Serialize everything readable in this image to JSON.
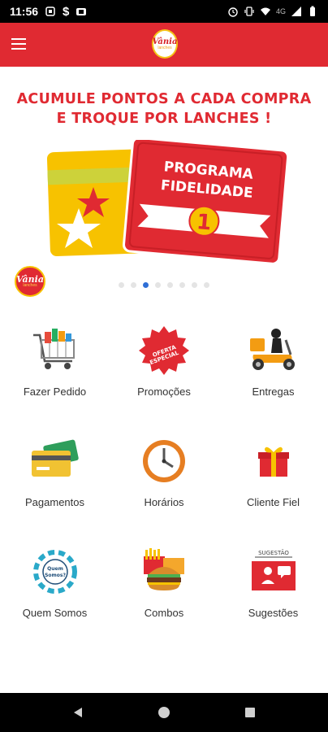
{
  "status_bar": {
    "time": "11:56",
    "network": "4G"
  },
  "app_bar": {
    "logo_script": "Vânia",
    "logo_tag": "lanches"
  },
  "banner": {
    "headline_line1": "ACUMULE PONTOS A CADA COMPRA",
    "headline_line2": "E TROQUE POR LANCHES !",
    "card_title_line1": "PROGRAMA",
    "card_title_line2": "FIDELIDADE",
    "card_number": "1",
    "logo_script": "Vânia",
    "logo_tag": "lanches",
    "dots_count": 8,
    "active_dot": 2
  },
  "menu": {
    "items": [
      {
        "label": "Fazer Pedido",
        "icon": "shopping-cart-icon"
      },
      {
        "label": "Promoções",
        "icon": "special-offer-badge-icon",
        "badge_text": "OFERTA ESPECIAL"
      },
      {
        "label": "Entregas",
        "icon": "delivery-scooter-icon"
      },
      {
        "label": "Pagamentos",
        "icon": "payment-cards-icon"
      },
      {
        "label": "Horários",
        "icon": "clock-icon"
      },
      {
        "label": "Cliente Fiel",
        "icon": "gift-box-icon"
      },
      {
        "label": "Quem Somos",
        "icon": "about-us-people-icon",
        "badge_text": "Quem Somos?"
      },
      {
        "label": "Combos",
        "icon": "burger-combo-icon"
      },
      {
        "label": "Sugestões",
        "icon": "suggestion-box-icon",
        "badge_text": "SUGESTÃO"
      }
    ]
  },
  "colors": {
    "brand_red": "#e02a32",
    "brand_yellow": "#f7c200",
    "dot_active": "#2f6fd6"
  }
}
